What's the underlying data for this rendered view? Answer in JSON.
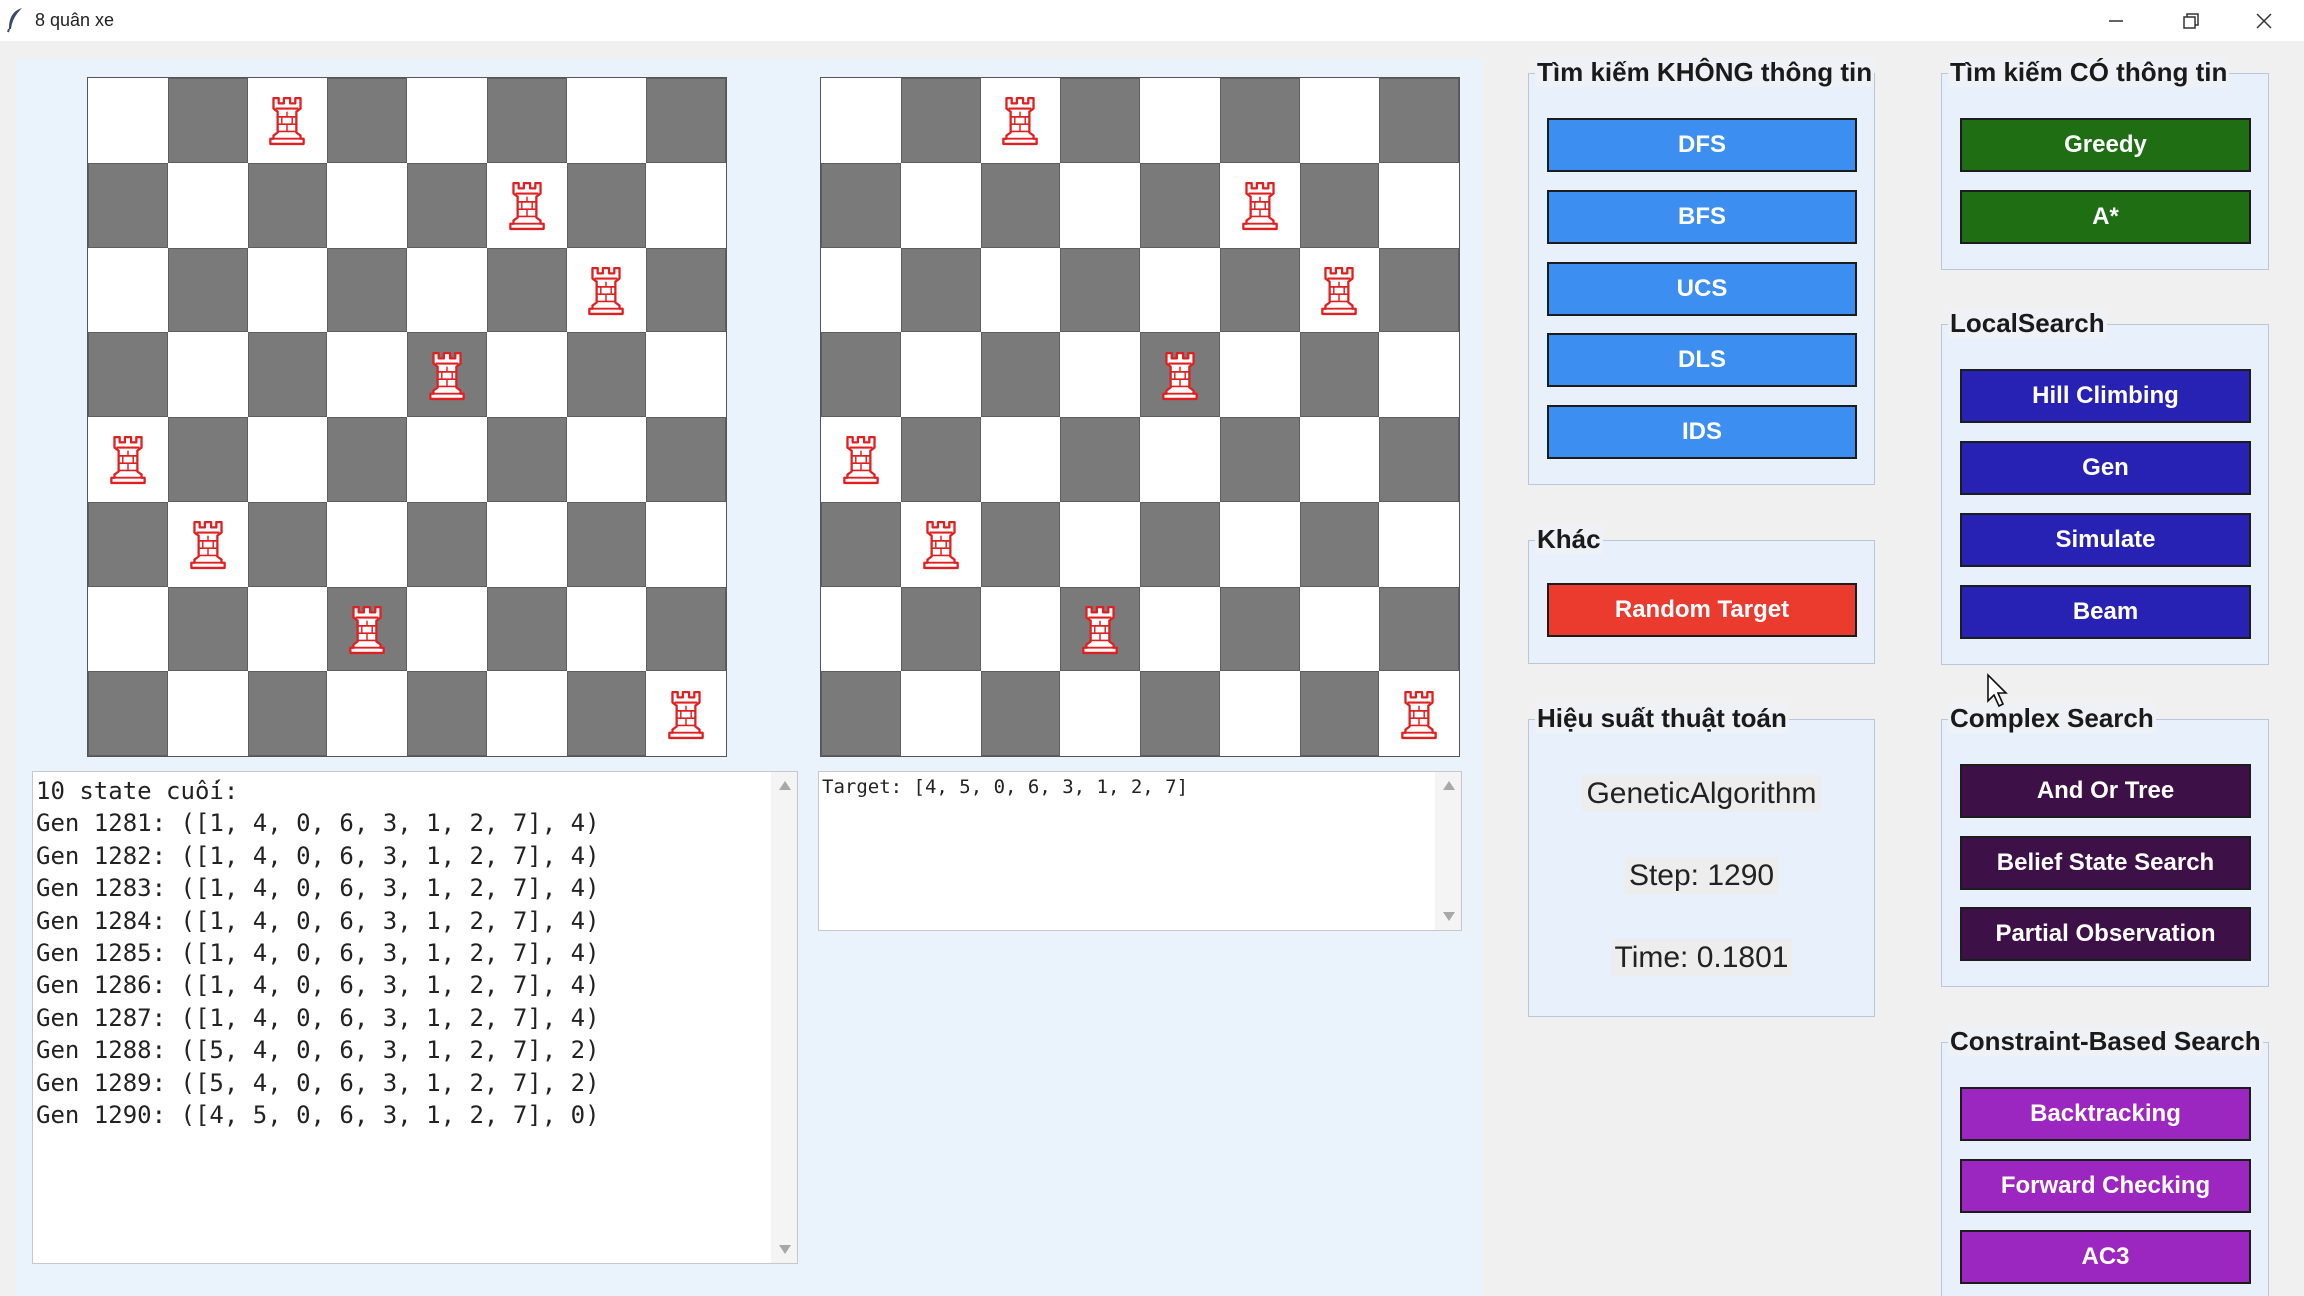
{
  "window": {
    "title": "8 quân xe",
    "icons": {
      "app": "feather-icon",
      "minimize": "minimize-icon",
      "restore": "restore-icon",
      "close": "close-icon"
    }
  },
  "boards": {
    "left": {
      "rooks": [
        2,
        5,
        6,
        4,
        0,
        1,
        3,
        7
      ]
    },
    "right": {
      "rooks": [
        2,
        5,
        6,
        4,
        0,
        1,
        3,
        7
      ]
    },
    "colors": {
      "dark": "#7a7a7a",
      "light": "#ffffff",
      "rook": "#e02020"
    }
  },
  "log": {
    "lines": [
      "10 state cuối:",
      "Gen 1281: ([1, 4, 0, 6, 3, 1, 2, 7], 4)",
      "Gen 1282: ([1, 4, 0, 6, 3, 1, 2, 7], 4)",
      "Gen 1283: ([1, 4, 0, 6, 3, 1, 2, 7], 4)",
      "Gen 1284: ([1, 4, 0, 6, 3, 1, 2, 7], 4)",
      "Gen 1285: ([1, 4, 0, 6, 3, 1, 2, 7], 4)",
      "Gen 1286: ([1, 4, 0, 6, 3, 1, 2, 7], 4)",
      "Gen 1287: ([1, 4, 0, 6, 3, 1, 2, 7], 4)",
      "Gen 1288: ([5, 4, 0, 6, 3, 1, 2, 7], 2)",
      "Gen 1289: ([5, 4, 0, 6, 3, 1, 2, 7], 2)",
      "Gen 1290: ([4, 5, 0, 6, 3, 1, 2, 7], 0)"
    ]
  },
  "target": {
    "text": "Target: [4, 5, 0, 6, 3, 1, 2, 7]"
  },
  "uninformed": {
    "title": "Tìm kiếm KHÔNG thông tin",
    "color": "#3c8ef0",
    "buttons": [
      "DFS",
      "BFS",
      "UCS",
      "DLS",
      "IDS"
    ]
  },
  "other": {
    "title": "Khác",
    "color": "#ea3b2e",
    "buttons": [
      "Random Target"
    ]
  },
  "performance": {
    "title": "Hiệu suất thuật toán",
    "algorithm": "GeneticAlgorithm",
    "step": "Step: 1290",
    "time": "Time: 0.1801"
  },
  "informed": {
    "title": "Tìm kiếm CÓ thông tin",
    "color": "#1f6e14",
    "buttons": [
      "Greedy",
      "A*"
    ]
  },
  "local": {
    "title": "LocalSearch",
    "color": "#2722b4",
    "buttons": [
      "Hill Climbing",
      "Gen",
      "Simulate",
      "Beam"
    ]
  },
  "complex": {
    "title": "Complex Search",
    "color": "#3d1147",
    "buttons": [
      "And Or Tree",
      "Belief State Search",
      "Partial Observation"
    ]
  },
  "constraint": {
    "title": "Constraint-Based Search",
    "color": "#9b27c0",
    "buttons": [
      "Backtracking",
      "Forward Checking",
      "AC3"
    ]
  }
}
